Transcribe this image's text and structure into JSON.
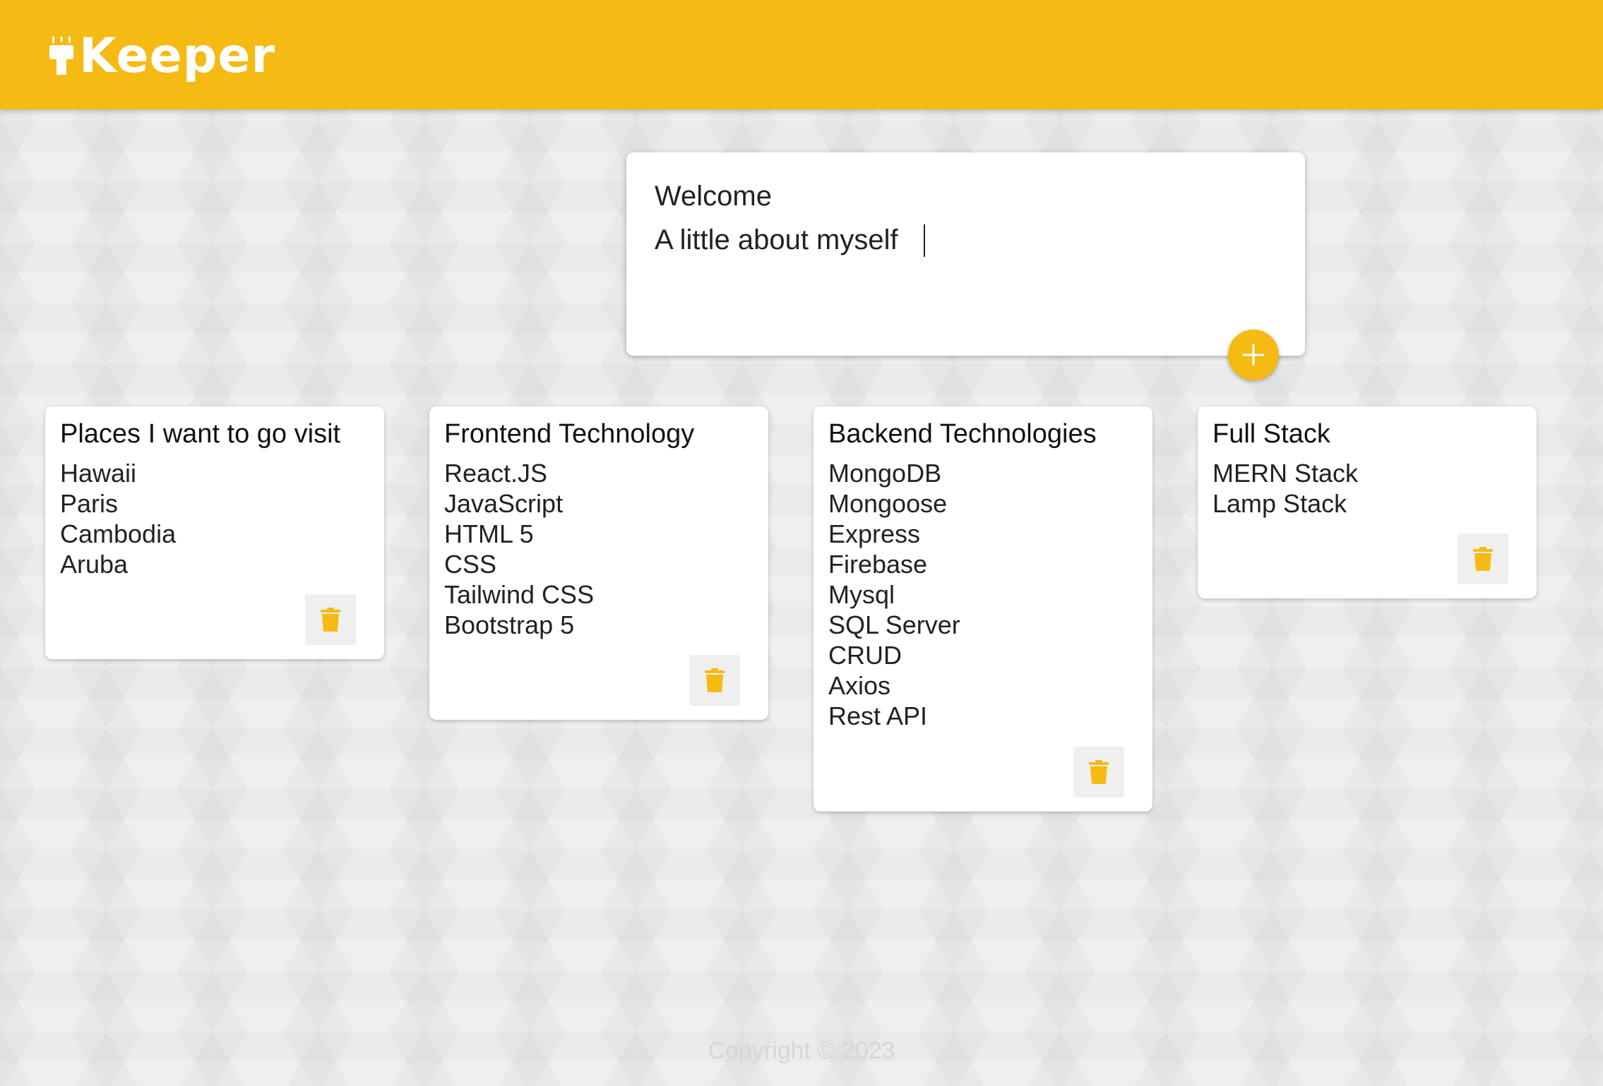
{
  "header": {
    "title": "Keeper",
    "icon": "lightbulb-icon",
    "background_color": "#f5ba13",
    "text_color": "#ffffff"
  },
  "create_note": {
    "title_value": "Welcome",
    "content_value": "A little about myself",
    "add_icon": "plus-icon"
  },
  "notes": [
    {
      "title": "Places I want to go visit",
      "lines": [
        "Hawaii",
        "Paris",
        "Cambodia",
        "Aruba"
      ]
    },
    {
      "title": "Frontend Technology",
      "lines": [
        "React.JS",
        "JavaScript",
        "HTML 5",
        "CSS",
        "Tailwind CSS",
        "Bootstrap 5"
      ]
    },
    {
      "title": "Backend Technologies",
      "lines": [
        "MongoDB",
        "Mongoose",
        "Express",
        "Firebase",
        "Mysql",
        "SQL Server",
        "CRUD",
        "Axios",
        "Rest API"
      ]
    },
    {
      "title": "Full Stack",
      "lines": [
        "MERN Stack",
        "Lamp Stack"
      ]
    }
  ],
  "delete_icon": "trash-icon",
  "accent_color": "#f5ba13",
  "footer": {
    "text": "Copyright © 2023"
  }
}
